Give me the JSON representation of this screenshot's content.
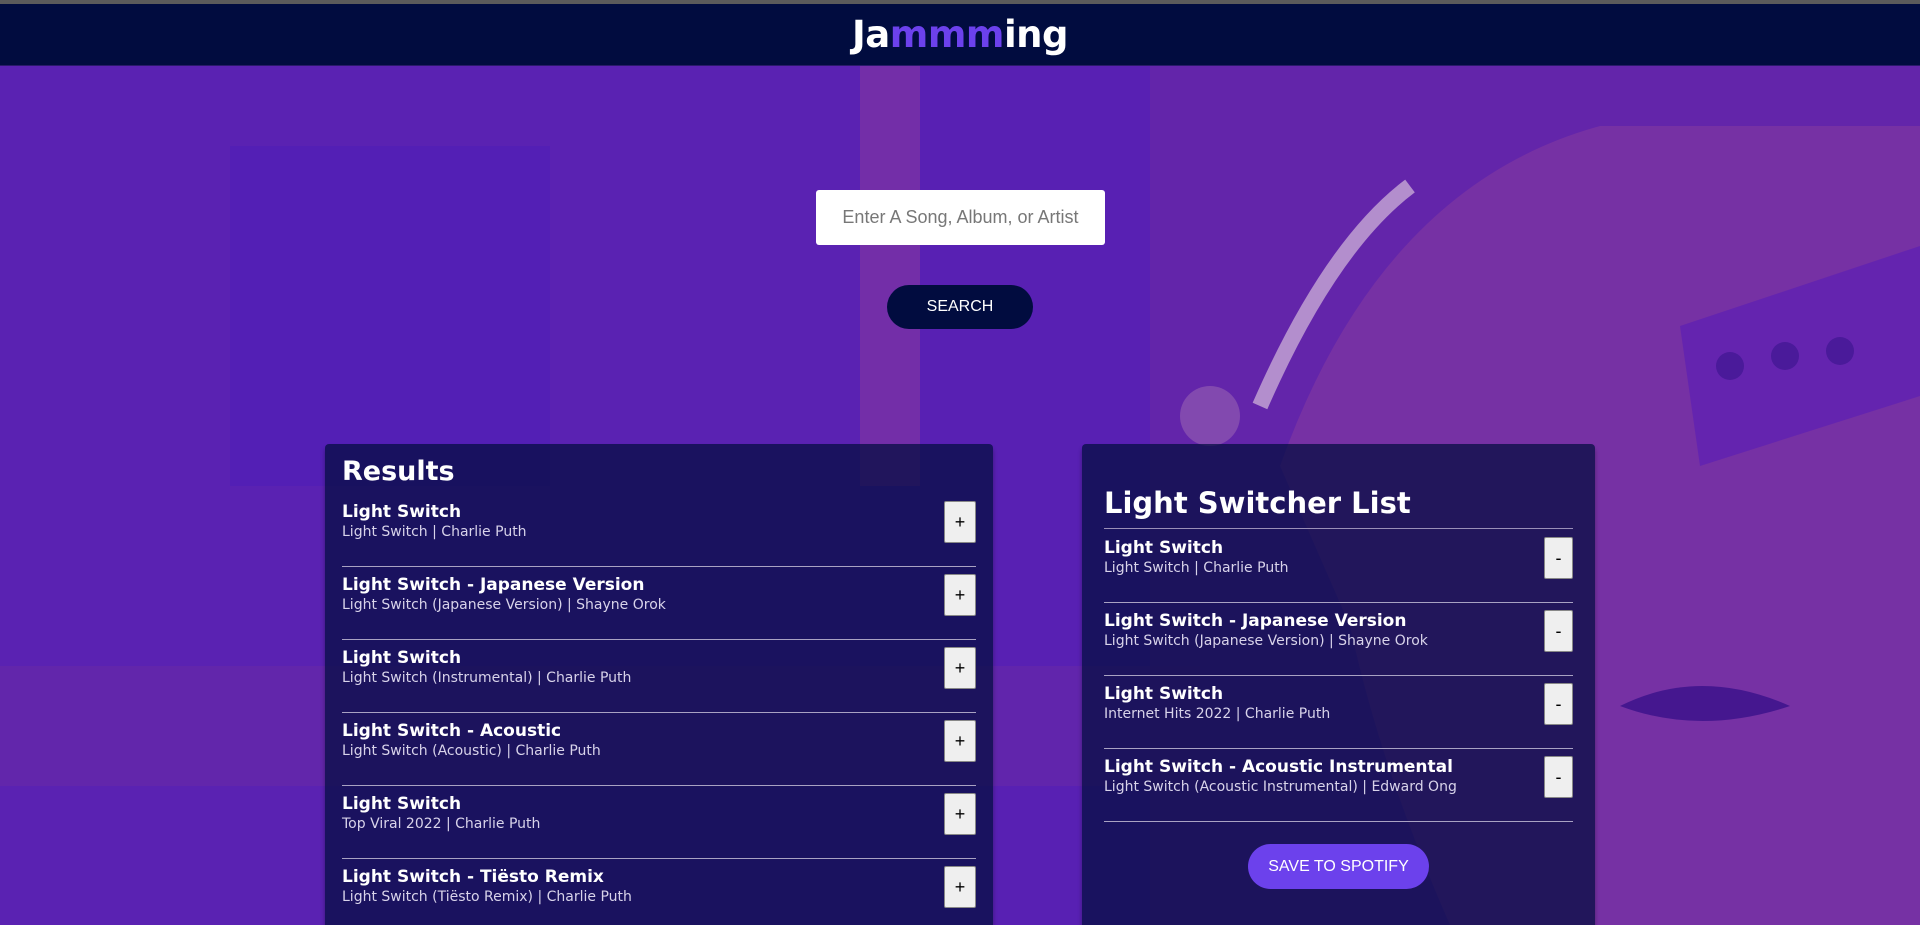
{
  "app": {
    "logo_parts": [
      "Ja",
      "mmm",
      "ing"
    ]
  },
  "search": {
    "placeholder": "Enter A Song, Album, or Artist",
    "value": "",
    "button_label": "SEARCH"
  },
  "results": {
    "title": "Results",
    "tracks": [
      {
        "name": "Light Switch",
        "info": "Light Switch | Charlie Puth",
        "action": "+"
      },
      {
        "name": "Light Switch - Japanese Version",
        "info": "Light Switch (Japanese Version) | Shayne Orok",
        "action": "+"
      },
      {
        "name": "Light Switch",
        "info": "Light Switch (Instrumental) | Charlie Puth",
        "action": "+"
      },
      {
        "name": "Light Switch - Acoustic",
        "info": "Light Switch (Acoustic) | Charlie Puth",
        "action": "+"
      },
      {
        "name": "Light Switch",
        "info": "Top Viral 2022 | Charlie Puth",
        "action": "+"
      },
      {
        "name": "Light Switch - Tiësto Remix",
        "info": "Light Switch (Tiësto Remix) | Charlie Puth",
        "action": "+"
      }
    ]
  },
  "playlist": {
    "title": "Light Switcher List",
    "tracks": [
      {
        "name": "Light Switch",
        "info": "Light Switch | Charlie Puth",
        "action": "-"
      },
      {
        "name": "Light Switch - Japanese Version",
        "info": "Light Switch (Japanese Version) | Shayne Orok",
        "action": "-"
      },
      {
        "name": "Light Switch",
        "info": "Internet Hits 2022 | Charlie Puth",
        "action": "-"
      },
      {
        "name": "Light Switch - Acoustic Instrumental",
        "info": "Light Switch (Acoustic Instrumental) | Edward Ong",
        "action": "-"
      }
    ],
    "save_label": "SAVE TO SPOTIFY"
  },
  "colors": {
    "header_bg": "#010c3f",
    "accent": "#6c41ec",
    "background": "#5b20b5"
  }
}
